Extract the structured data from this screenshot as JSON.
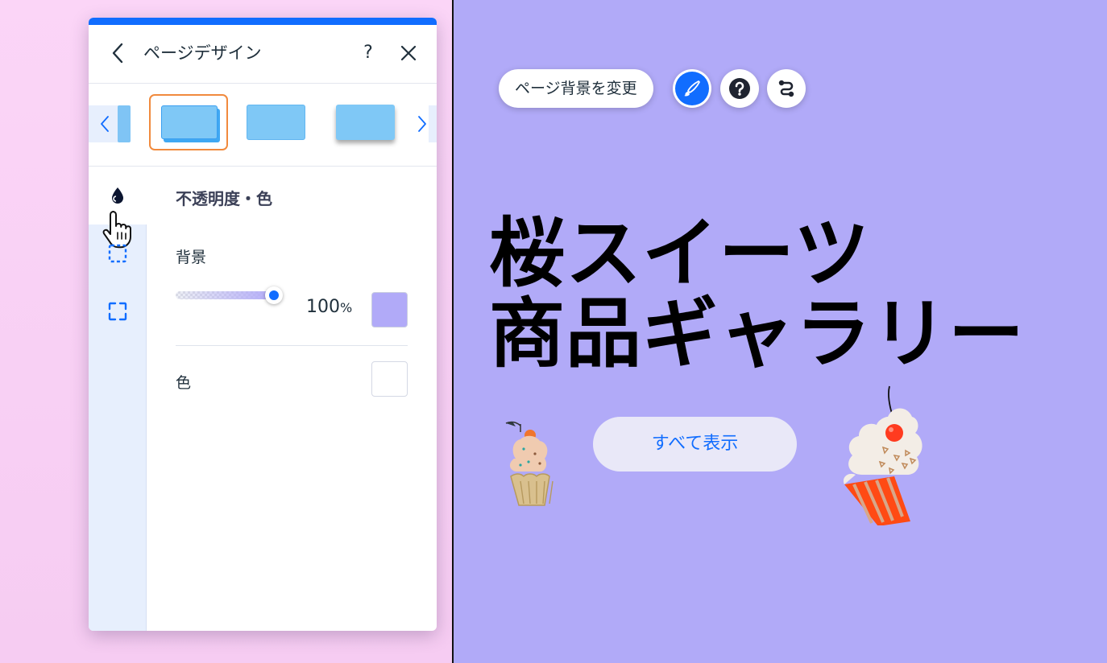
{
  "panel": {
    "title": "ページデザイン",
    "help_label": "?",
    "section_title": "不透明度・色",
    "background_label": "背景",
    "opacity_value": "100",
    "opacity_unit": "%",
    "opacity_fraction": 1.0,
    "color_label": "色",
    "background_swatch_color": "#b1aaf8",
    "color_swatch_color": "#ffffff",
    "accent_color": "#116dff",
    "selected_thumb_border": "#f18a3d"
  },
  "toolbar": {
    "change_bg_label": "ページ背景を変更",
    "paint_icon": "brush-icon",
    "help_icon": "question-icon",
    "connect_icon": "path-icon"
  },
  "canvas": {
    "background_color": "#b1aaf8",
    "headline_line1": "桜スイーツ",
    "headline_line2": "商品ギャラリー",
    "show_all_label": "すべて表示"
  }
}
